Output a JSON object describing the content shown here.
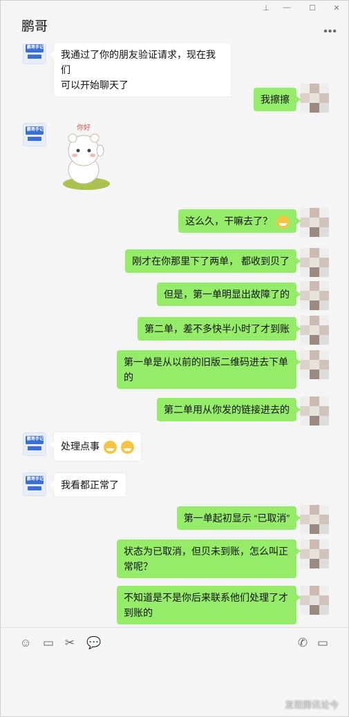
{
  "window": {
    "title": "鹏哥"
  },
  "contact_avatar_text": "鹏哥手记",
  "messages": [
    {
      "side": "left",
      "text_lines": [
        "我通过了你的朋友验证请求，现在我们",
        "可以开始聊天了"
      ]
    },
    {
      "side": "right",
      "text": "我擦擦"
    },
    {
      "side": "left",
      "sticker": "你好"
    },
    {
      "side": "right",
      "text": "这么久，干嘛去了？"
    },
    {
      "side": "right",
      "text": "刚才在你那里下了两单， 都收到贝了"
    },
    {
      "side": "right",
      "text": "但是，第一单明显出故障了的"
    },
    {
      "side": "right",
      "text": "第二单，差不多快半小时了才到账"
    },
    {
      "side": "right",
      "text_lines": [
        "第一单是从以前的旧版二维码进去下单",
        "的"
      ]
    },
    {
      "side": "right",
      "text": "第二单用从你发的链接进去的"
    },
    {
      "side": "left",
      "text": "处理点事"
    },
    {
      "side": "left",
      "text": "我看都正常了"
    },
    {
      "side": "right",
      "text": "第一单起初显示 “已取消”"
    },
    {
      "side": "right",
      "text_lines": [
        "状态为已取消，但贝未到账，怎么叫正",
        "常呢？"
      ]
    },
    {
      "side": "right",
      "text_lines": [
        "不知道是不是你后来联系他们处理了才",
        "到账的"
      ]
    }
  ],
  "toolbar": {
    "icons": [
      "emoji-icon",
      "folder-icon",
      "scissors-icon",
      "chat-bubble-icon",
      "phone-icon",
      "video-icon"
    ]
  },
  "watermark": "发现腾讯论今",
  "colors": {
    "sent_bubble": "#95ec69",
    "received_bubble": "#ffffff",
    "background": "#f5f5f5"
  }
}
